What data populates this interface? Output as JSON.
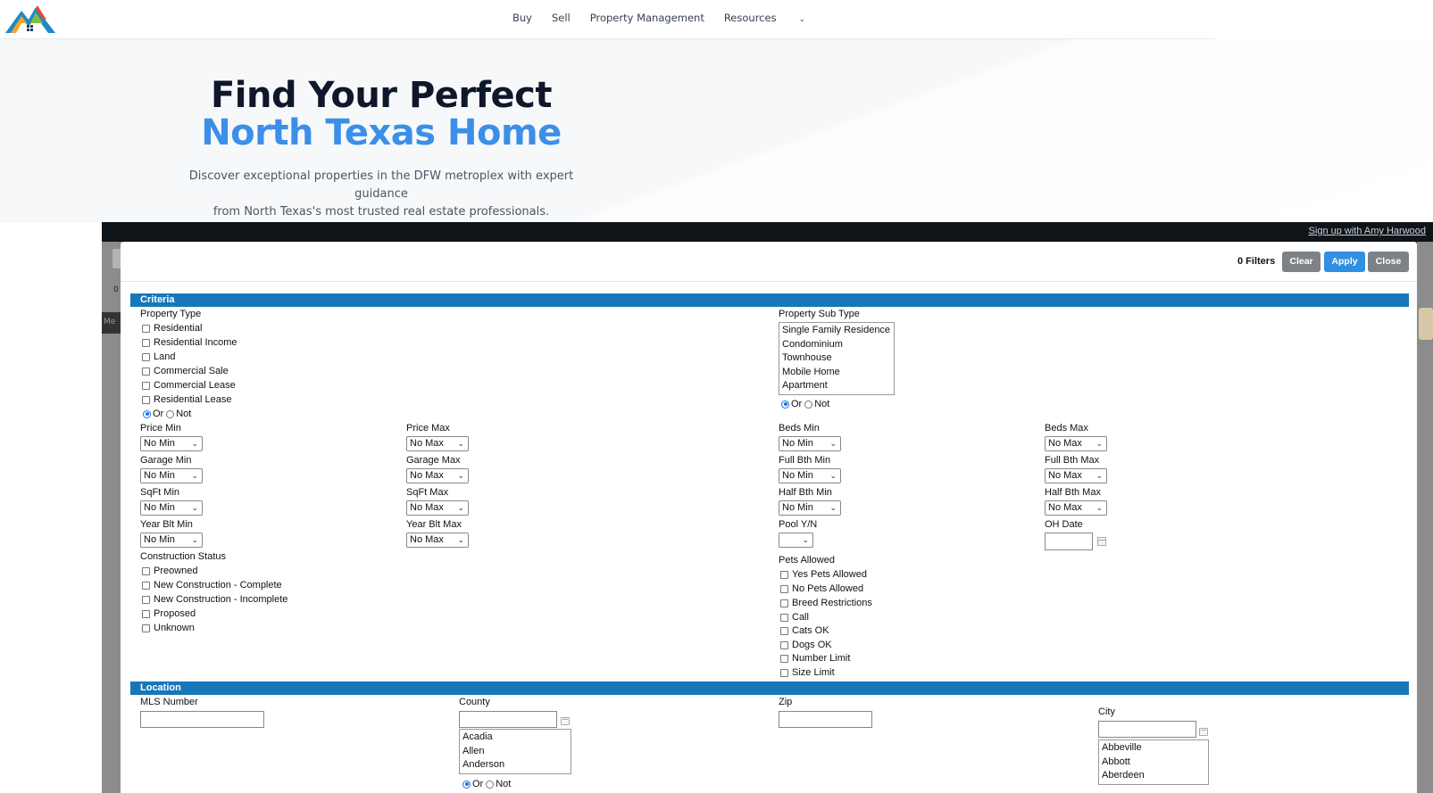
{
  "nav": {
    "items": [
      {
        "label": "Buy"
      },
      {
        "label": "Sell"
      },
      {
        "label": "Property Management"
      },
      {
        "label": "Resources"
      }
    ]
  },
  "hero": {
    "title_line1": "Find Your Perfect",
    "title_line2": "North Texas Home",
    "subtitle_line1": "Discover exceptional properties in the DFW metroplex with expert guidance",
    "subtitle_line2": "from North Texas's most trusted real estate professionals."
  },
  "widget": {
    "signup_link": "Sign up with Amy Harwood",
    "ghost_left_num": "0",
    "ghost_left_tab": "Me"
  },
  "modal": {
    "filters_count": "0 Filters",
    "clear_label": "Clear",
    "apply_label": "Apply",
    "close_label": "Close",
    "criteria_title": "Criteria",
    "location_title": "Location",
    "property_type": {
      "label": "Property Type",
      "options": [
        "Residential",
        "Residential Income",
        "Land",
        "Commercial Sale",
        "Commercial Lease",
        "Residential Lease"
      ]
    },
    "property_sub_type": {
      "label": "Property Sub Type",
      "options": [
        "Single Family Residence",
        "Condominium",
        "Townhouse",
        "Mobile Home",
        "Apartment"
      ]
    },
    "or_label": "Or",
    "not_label": "Not",
    "fields": {
      "price_min": {
        "label": "Price Min",
        "value": "No Min"
      },
      "price_max": {
        "label": "Price Max",
        "value": "No Max"
      },
      "beds_min": {
        "label": "Beds Min",
        "value": "No Min"
      },
      "beds_max": {
        "label": "Beds Max",
        "value": "No Max"
      },
      "garage_min": {
        "label": "Garage Min",
        "value": "No Min"
      },
      "garage_max": {
        "label": "Garage Max",
        "value": "No Max"
      },
      "full_bth_min": {
        "label": "Full Bth Min",
        "value": "No Min"
      },
      "full_bth_max": {
        "label": "Full Bth Max",
        "value": "No Max"
      },
      "sqft_min": {
        "label": "SqFt Min",
        "value": "No Min"
      },
      "sqft_max": {
        "label": "SqFt Max",
        "value": "No Max"
      },
      "half_bth_min": {
        "label": "Half Bth Min",
        "value": "No Min"
      },
      "half_bth_max": {
        "label": "Half Bth Max",
        "value": "No Max"
      },
      "year_blt_min": {
        "label": "Year Blt Min",
        "value": "No Min"
      },
      "year_blt_max": {
        "label": "Year Blt Max",
        "value": "No Max"
      },
      "pool": {
        "label": "Pool Y/N",
        "value": ""
      },
      "oh_date": {
        "label": "OH Date",
        "value": ""
      }
    },
    "construction_status": {
      "label": "Construction Status",
      "options": [
        "Preowned",
        "New Construction - Complete",
        "New Construction - Incomplete",
        "Proposed",
        "Unknown"
      ]
    },
    "pets_allowed": {
      "label": "Pets Allowed",
      "options": [
        "Yes Pets Allowed",
        "No Pets Allowed",
        "Breed Restrictions",
        "Call",
        "Cats OK",
        "Dogs OK",
        "Number Limit",
        "Size Limit"
      ]
    },
    "location": {
      "mls_label": "MLS Number",
      "county_label": "County",
      "county_options": [
        "Acadia",
        "Allen",
        "Anderson"
      ],
      "zip_label": "Zip",
      "city_label": "City",
      "city_options": [
        "Abbeville",
        "Abbott",
        "Aberdeen"
      ]
    }
  }
}
